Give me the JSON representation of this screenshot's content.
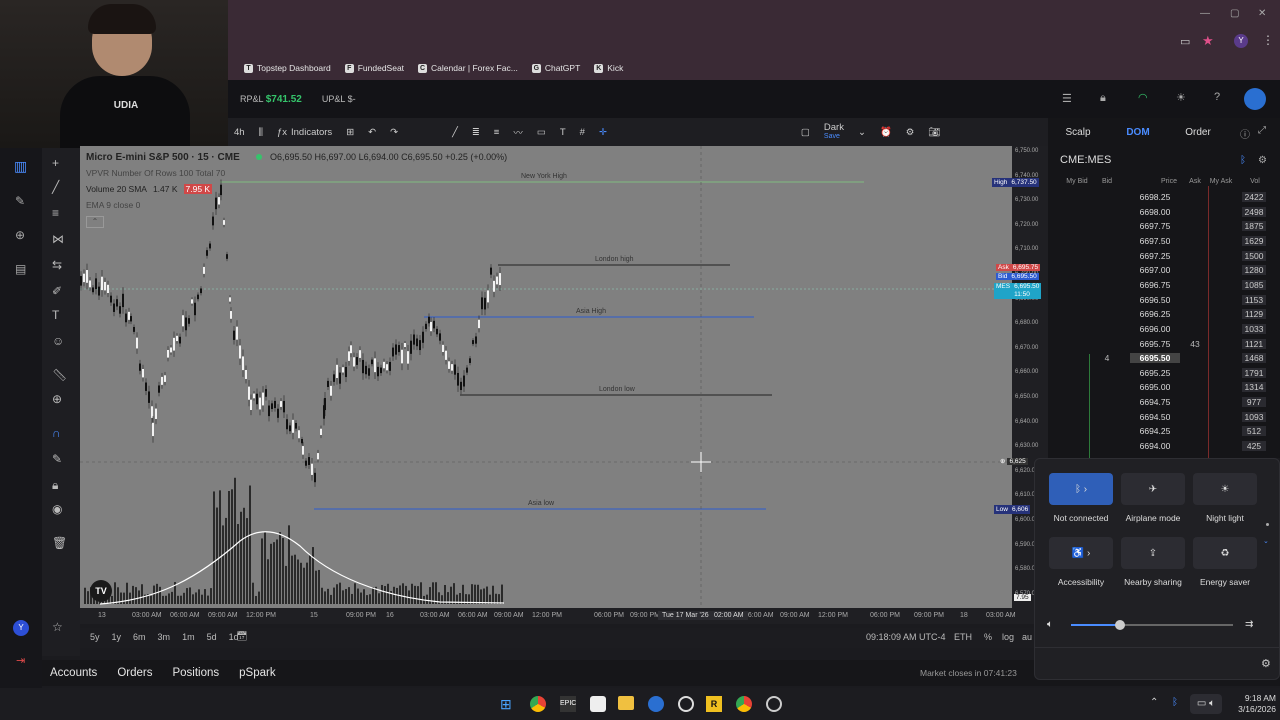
{
  "browser": {
    "bookmarks": [
      {
        "label": "Topstep Dashboard",
        "icon": "T"
      },
      {
        "label": "FundedSeat",
        "icon": "F"
      },
      {
        "label": "Calendar | Forex Fac...",
        "icon": "C"
      },
      {
        "label": "ChatGPT",
        "icon": "G"
      },
      {
        "label": "Kick",
        "icon": "K"
      }
    ],
    "profile_initial": "Y"
  },
  "header": {
    "rpl_label": "RP&L",
    "rpl_value": "$741.52",
    "upl_label": "UP&L",
    "upl_value": "$-"
  },
  "chart_toolbar": {
    "interval": "4h",
    "indicators_label": "Indicators",
    "theme_label": "Dark",
    "save_label": "Save"
  },
  "chart": {
    "symbol_title": "Micro E-mini S&P 500 · 15 · CME",
    "ohlc": "O6,695.50 H6,697.00 L6,694.00 C6,695.50 +0.25 (+0.00%)",
    "indicator1": "VPVR Number Of Rows 100 Total 70",
    "indicator2_label": "Volume 20 SMA",
    "indicator2_v1": "1.47 K",
    "indicator2_v2": "7.95 K",
    "indicator3": "EMA 9 close 0",
    "levels": {
      "ny_high": "New York High",
      "london_high": "London high",
      "asia_high": "Asia High",
      "london_low": "London low",
      "asia_low": "Asia low"
    },
    "price_axis": [
      "6,750.00",
      "6,740.00",
      "6,730.00",
      "6,720.00",
      "6,710.00",
      "6,700.00",
      "6,690.00",
      "6,680.00",
      "6,670.00",
      "6,660.00",
      "6,650.00",
      "6,640.00",
      "6,630.00",
      "6,620.00",
      "6,610.00",
      "6,600.00",
      "6,590.00",
      "6,580.00",
      "6,570.00"
    ],
    "badges": {
      "high_label": "High",
      "high_value": "6,737.50",
      "ask_label": "Ask",
      "ask_value": "6,695.75",
      "bid_label": "Bid",
      "bid_value": "6,695.50",
      "mes_label": "MES",
      "mes_value": "6,695.50",
      "mes_timer": "11:50",
      "cross_value": "6,625",
      "low_label": "Low",
      "low_value": "6,606",
      "vol_value": "7.95"
    },
    "time_axis": [
      "13",
      "03:00 AM",
      "06:00 AM",
      "09:00 AM",
      "12:00 PM",
      "15",
      "09:00 PM",
      "16",
      "03:00 AM",
      "06:00 AM",
      "09:00 AM",
      "12:00 PM",
      "06:00 PM",
      "09:00 PM",
      "02:00 AM",
      "06:00 AM",
      "09:00 AM",
      "12:00 PM",
      "06:00 PM",
      "09:00 PM",
      "18",
      "03:00 AM"
    ],
    "crosshair_date": "Tue 17 Mar '26",
    "crosshair_time": "02:00 AM"
  },
  "range_bar": {
    "ranges": [
      "5y",
      "1y",
      "6m",
      "3m",
      "1m",
      "5d",
      "1d"
    ],
    "clock": "09:18:09 AM UTC-4",
    "session": "ETH",
    "pct": "%",
    "log": "log",
    "auto": "au"
  },
  "bottom_tabs": [
    "Accounts",
    "Orders",
    "Positions",
    "pSpark"
  ],
  "market_close": "Market closes in 07:41:23",
  "dom": {
    "tabs": [
      "Scalp",
      "DOM",
      "Order"
    ],
    "symbol": "CME:MES",
    "headers": [
      "My Bid",
      "Bid",
      "Price",
      "Ask",
      "My Ask",
      "Vol"
    ],
    "rows": [
      {
        "price": "6698.25",
        "bid": "",
        "ask": "",
        "vol": "2422"
      },
      {
        "price": "6698.00",
        "bid": "",
        "ask": "",
        "vol": "2498"
      },
      {
        "price": "6697.75",
        "bid": "",
        "ask": "",
        "vol": "1875"
      },
      {
        "price": "6697.50",
        "bid": "",
        "ask": "",
        "vol": "1629"
      },
      {
        "price": "6697.25",
        "bid": "",
        "ask": "",
        "vol": "1500"
      },
      {
        "price": "6697.00",
        "bid": "",
        "ask": "",
        "vol": "1280"
      },
      {
        "price": "6696.75",
        "bid": "",
        "ask": "",
        "vol": "1085"
      },
      {
        "price": "6696.50",
        "bid": "",
        "ask": "",
        "vol": "1153"
      },
      {
        "price": "6696.25",
        "bid": "",
        "ask": "",
        "vol": "1129"
      },
      {
        "price": "6696.00",
        "bid": "",
        "ask": "",
        "vol": "1033"
      },
      {
        "price": "6695.75",
        "bid": "",
        "ask": "43",
        "vol": "1121"
      },
      {
        "price": "6695.50",
        "bid": "4",
        "ask": "",
        "vol": "1468",
        "current": true
      },
      {
        "price": "6695.25",
        "bid": "",
        "ask": "",
        "vol": "1791"
      },
      {
        "price": "6695.00",
        "bid": "",
        "ask": "",
        "vol": "1314"
      },
      {
        "price": "6694.75",
        "bid": "",
        "ask": "",
        "vol": "977"
      },
      {
        "price": "6694.50",
        "bid": "",
        "ask": "",
        "vol": "1093"
      },
      {
        "price": "6694.25",
        "bid": "",
        "ask": "",
        "vol": "512"
      },
      {
        "price": "6694.00",
        "bid": "",
        "ask": "",
        "vol": "425"
      }
    ]
  },
  "quick_settings": {
    "tiles": [
      {
        "label": "Not connected",
        "icon": "bluetooth-icon",
        "active": true
      },
      {
        "label": "Airplane mode",
        "icon": "airplane-icon",
        "active": false
      },
      {
        "label": "Night light",
        "icon": "night-light-icon",
        "active": false
      },
      {
        "label": "Accessibility",
        "icon": "accessibility-icon",
        "active": false
      },
      {
        "label": "Nearby sharing",
        "icon": "nearby-sharing-icon",
        "active": false
      },
      {
        "label": "Energy saver",
        "icon": "energy-saver-icon",
        "active": false
      }
    ],
    "volume_level": 0.3
  },
  "taskbar": {
    "time": "9:18 AM",
    "date": "3/16/2026"
  }
}
